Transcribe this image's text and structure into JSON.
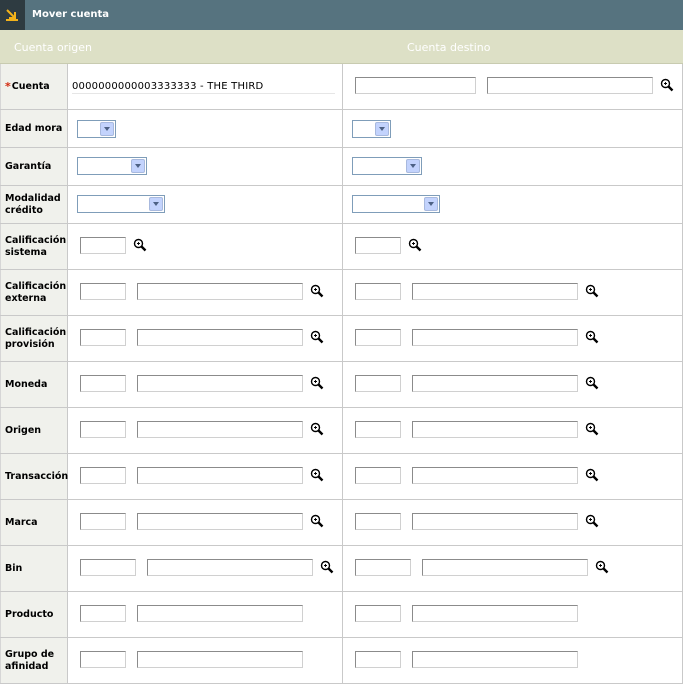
{
  "window": {
    "title": "Mover cuenta",
    "icon": "move-arrow-icon"
  },
  "header": {
    "origin": "Cuenta origen",
    "destination": "Cuenta destino"
  },
  "colors": {
    "titlebar": "#56737f",
    "header": "#dde0c6",
    "label_bg": "#f0f1ec",
    "required": "#d32a0e"
  },
  "fields": {
    "cuenta": {
      "label": "Cuenta",
      "required_mark": "*",
      "origin_value": "0000000000003333333 - THE THIRD"
    },
    "edad_mora": {
      "label": "Edad mora"
    },
    "garantia": {
      "label": "Garantía"
    },
    "modalidad": {
      "label": "Modalidad crédito"
    },
    "calif_sistema": {
      "label": "Calificación sistema"
    },
    "calif_externa": {
      "label": "Calificación externa"
    },
    "calif_provision": {
      "label": "Calificación provisión"
    },
    "moneda": {
      "label": "Moneda"
    },
    "origen": {
      "label": "Origen"
    },
    "transaccion": {
      "label": "Transacción"
    },
    "marca": {
      "label": "Marca"
    },
    "bin": {
      "label": "Bin"
    },
    "producto": {
      "label": "Producto"
    },
    "grupo": {
      "label": "Grupo de afinidad"
    }
  },
  "icons": {
    "search": "magnifier-icon",
    "dropdown": "chevron-down-icon"
  }
}
